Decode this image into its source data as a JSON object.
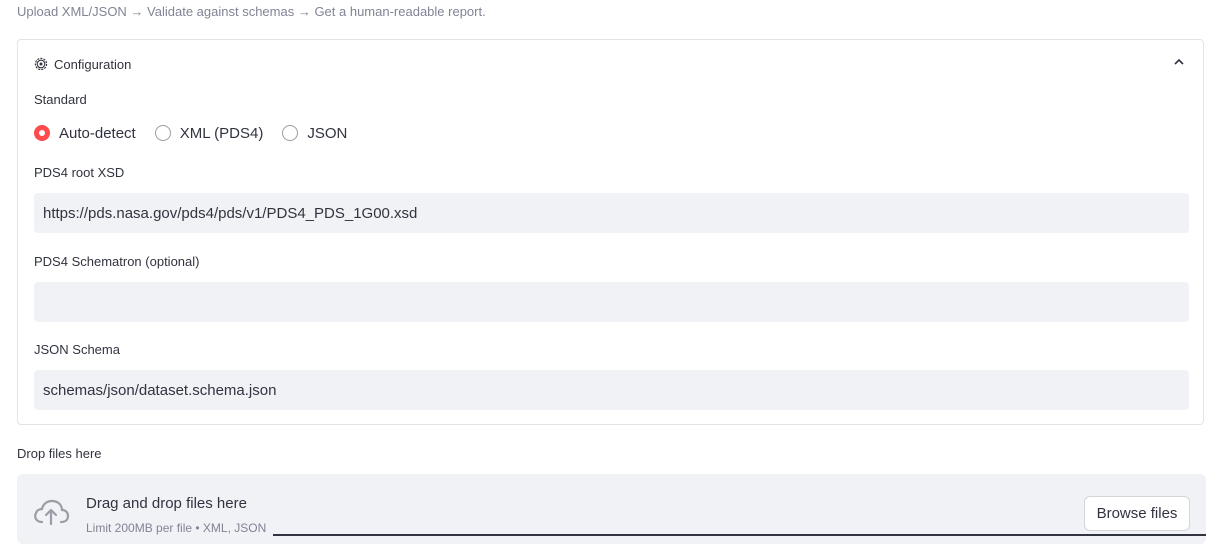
{
  "caption": "Upload XML/JSON → Validate against schemas → Get a human-readable report.",
  "config": {
    "title": "Configuration",
    "icon": "gear-icon",
    "collapse_icon": "chevron-up-icon",
    "standard_label": "Standard",
    "standard_options": [
      "Auto-detect",
      "XML (PDS4)",
      "JSON"
    ],
    "standard_selected": "Auto-detect",
    "pds4_xsd_label": "PDS4 root XSD",
    "pds4_xsd_value": "https://pds.nasa.gov/pds4/pds/v1/PDS4_PDS_1G00.xsd",
    "schematron_label": "PDS4 Schematron (optional)",
    "schematron_value": "",
    "json_schema_label": "JSON Schema",
    "json_schema_value": "schemas/json/dataset.schema.json"
  },
  "uploader": {
    "label": "Drop files here",
    "icon": "cloud-upload-icon",
    "title": "Drag and drop files here",
    "subtitle": "Limit 200MB per file • XML, JSON",
    "browse_label": "Browse files"
  },
  "colors": {
    "accent": "#ff4b4b",
    "input_bg": "#f0f2f6",
    "text": "#31333f",
    "muted": "#808495"
  }
}
